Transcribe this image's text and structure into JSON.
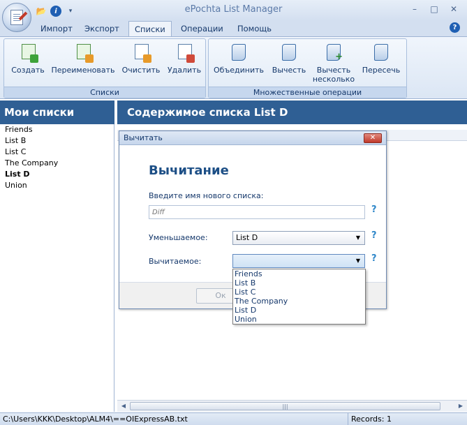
{
  "window": {
    "title": "ePochta List Manager",
    "min_glyph": "–",
    "max_glyph": "□",
    "close_glyph": "✕"
  },
  "quick_access": {
    "folder_glyph": "📂",
    "info_glyph": "i",
    "more_glyph": "▾"
  },
  "menu": {
    "tabs": [
      "Импорт",
      "Экспорт",
      "Списки",
      "Операции",
      "Помощь"
    ],
    "active_tab": "Списки",
    "help_glyph": "?"
  },
  "ribbon": {
    "groups": [
      {
        "label": "Списки",
        "buttons": [
          "Создать",
          "Переименовать",
          "Очистить",
          "Удалить"
        ]
      },
      {
        "label": "Множественные операции",
        "buttons": [
          "Объединить",
          "Вычесть",
          "Вычесть несколько",
          "Пересечь"
        ]
      }
    ]
  },
  "left_panel": {
    "title": "Мои списки",
    "items": [
      "Friends",
      "List B",
      "List C",
      "The Company",
      "List D",
      "Union"
    ],
    "selected": "List D"
  },
  "right_panel": {
    "title": "Содержимое списка List D"
  },
  "scrollbar": {
    "left_glyph": "◀",
    "right_glyph": "▶",
    "thumb_grip": "|||"
  },
  "status_bar": {
    "path": "C:\\Users\\KKK\\Desktop\\ALM4\\==OIExpressAB.txt",
    "records": "Records: 1"
  },
  "dialog": {
    "window_title": "Вычитать",
    "close_glyph": "✕",
    "heading": "Вычитание",
    "new_list_label": "Введите имя нового списка:",
    "new_list_placeholder": "Diff",
    "help_glyph": "?",
    "minuend_label": "Уменьшаемое:",
    "minuend_value": "List D",
    "subtrahend_label": "Вычитаемое:",
    "subtrahend_value": "",
    "dropdown_glyph": "▼",
    "ok_label": "Ок",
    "dropdown_options": [
      "Friends",
      "List B",
      "List C",
      "The Company",
      "List D",
      "Union"
    ]
  }
}
